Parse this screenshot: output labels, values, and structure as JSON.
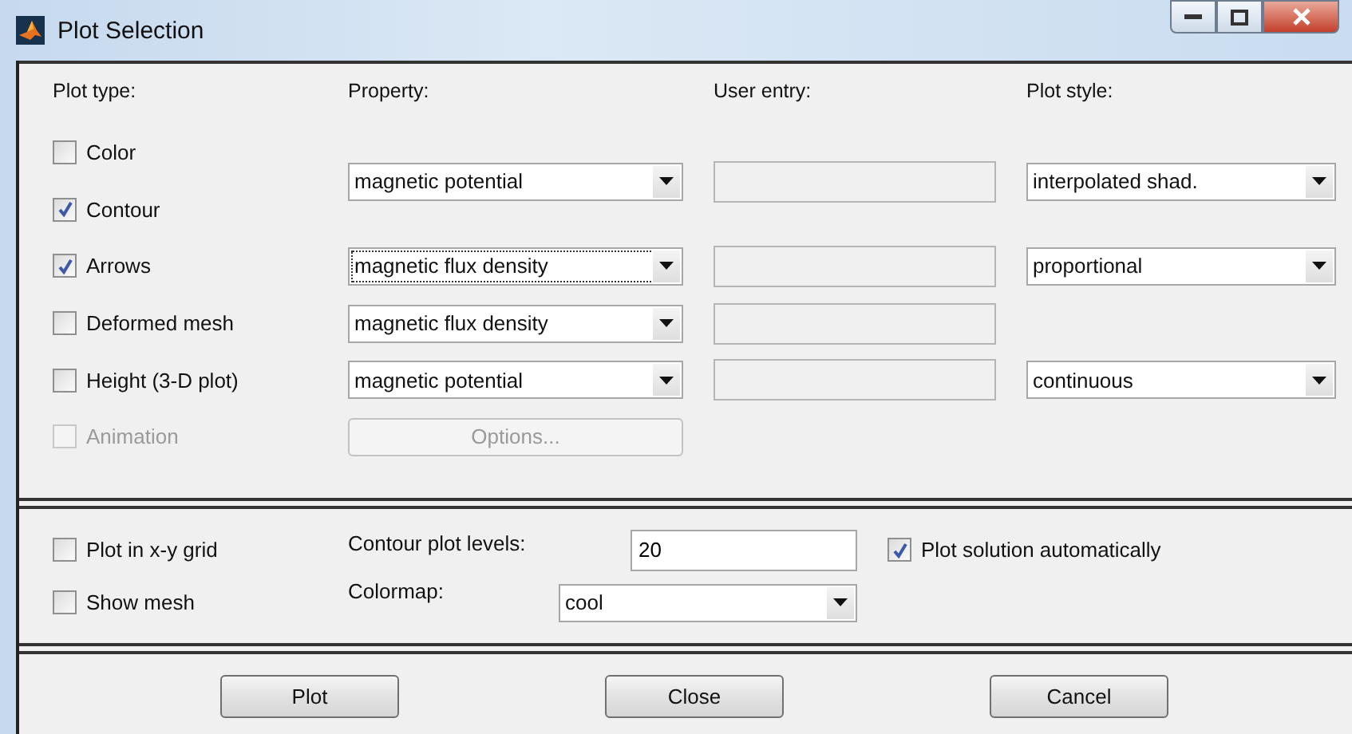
{
  "window": {
    "title": "Plot Selection"
  },
  "headers": [
    "Plot type:",
    "Property:",
    "User entry:",
    "Plot style:"
  ],
  "plot_types": [
    {
      "label": "Color",
      "checked": false,
      "disabled": false
    },
    {
      "label": "Contour",
      "checked": true,
      "disabled": false
    },
    {
      "label": "Arrows",
      "checked": true,
      "disabled": false
    },
    {
      "label": "Deformed mesh",
      "checked": false,
      "disabled": false
    },
    {
      "label": "Height (3-D plot)",
      "checked": false,
      "disabled": false
    },
    {
      "label": "Animation",
      "checked": false,
      "disabled": true
    }
  ],
  "property_rows": [
    {
      "property": "magnetic potential",
      "focused": false,
      "plot_style": "interpolated shad."
    },
    {
      "property": "magnetic flux density",
      "focused": true,
      "plot_style": "proportional"
    },
    {
      "property": "magnetic flux density",
      "focused": false
    },
    {
      "property": "magnetic potential",
      "focused": false,
      "plot_style": "continuous"
    }
  ],
  "options_button": {
    "label": "Options...",
    "disabled": true
  },
  "plot_in_grid": {
    "label": "Plot in x-y grid",
    "checked": false
  },
  "show_mesh": {
    "label": "Show mesh",
    "checked": false
  },
  "contour_levels": {
    "label": "Contour plot levels:",
    "value": "20"
  },
  "colormap": {
    "label": "Colormap:",
    "value": "cool"
  },
  "plot_automatically": {
    "label": "Plot solution automatically",
    "checked": true
  },
  "buttons": [
    "Plot",
    "Close",
    "Cancel"
  ]
}
